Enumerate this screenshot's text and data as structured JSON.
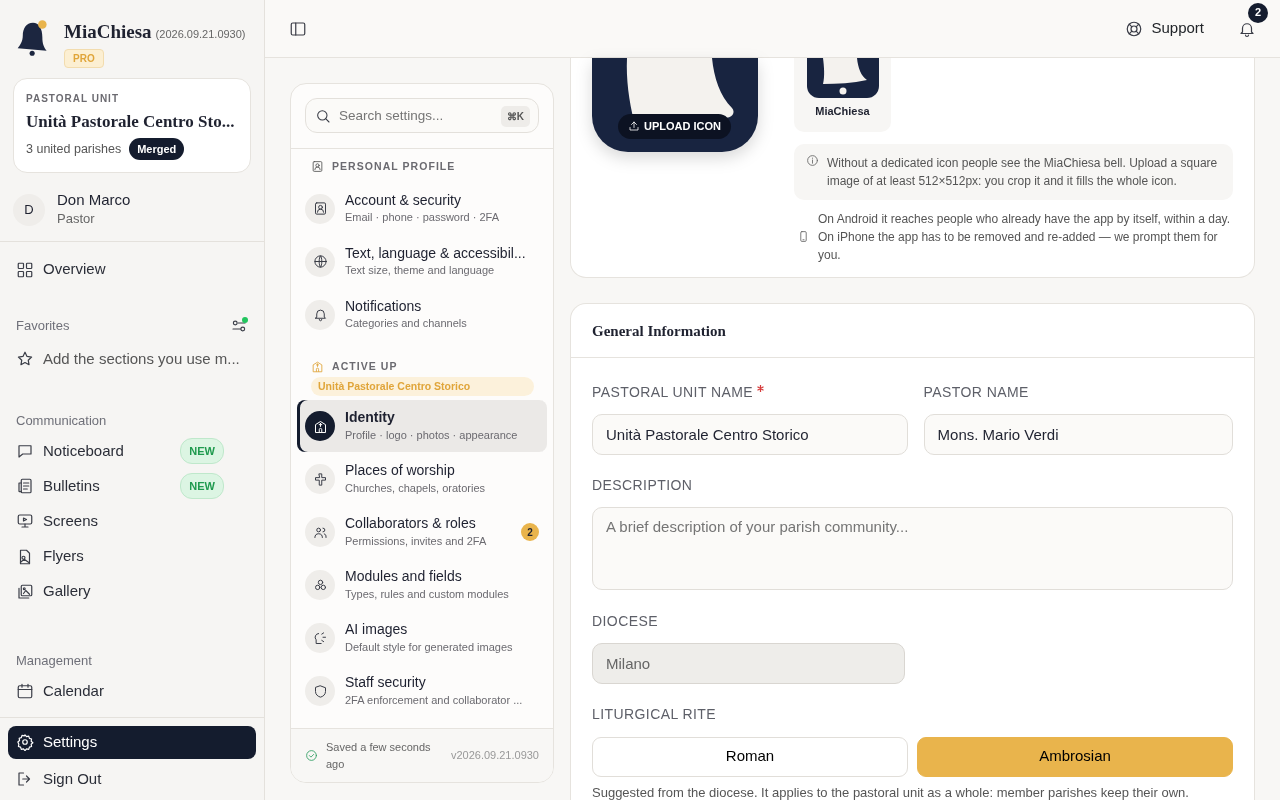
{
  "app": {
    "name": "MiaChiesa",
    "version": "(2026.09.21.0930)",
    "plan": "PRO"
  },
  "unit_card": {
    "label": "PASTORAL UNIT",
    "name": "Unità Pastorale Centro Sto...",
    "subtitle": "3 united parishes",
    "badge": "Merged"
  },
  "user": {
    "initial": "D",
    "name": "Don Marco",
    "role": "Pastor"
  },
  "overview": {
    "label": "Overview",
    "selected": false
  },
  "favorites": {
    "title": "Favorites",
    "hint": "Add the sections you use m..."
  },
  "nav_groups": [
    {
      "title": "Communication",
      "items": [
        {
          "label": "Noticeboard",
          "badge": "NEW",
          "selected": false
        },
        {
          "label": "Bulletins",
          "badge": "NEW",
          "selected": false
        },
        {
          "label": "Screens",
          "selected": false
        },
        {
          "label": "Flyers",
          "selected": false
        },
        {
          "label": "Gallery",
          "selected": false
        }
      ]
    },
    {
      "title": "Management",
      "items": [
        {
          "label": "Calendar",
          "selected": false
        }
      ]
    }
  ],
  "bottom_nav": [
    {
      "label": "Settings",
      "selected": true
    },
    {
      "label": "Sign Out",
      "selected": false
    }
  ],
  "header": {
    "support": "Support",
    "notifications": "2"
  },
  "settings_nav": {
    "search_placeholder": "Search settings...",
    "shortcut": "⌘K",
    "sections": [
      {
        "title": "PERSONAL PROFILE",
        "items": [
          {
            "title": "Account & security",
            "subtitle": "Email · phone · password · 2FA",
            "selected": false
          },
          {
            "title": "Text, language & accessibil...",
            "subtitle": "Text size, theme and language",
            "selected": false
          },
          {
            "title": "Notifications",
            "subtitle": "Categories and channels",
            "selected": false
          }
        ]
      },
      {
        "title": "ACTIVE UP",
        "tag": "Unità Pastorale Centro Storico",
        "items": [
          {
            "title": "Identity",
            "subtitle": "Profile · logo · photos · appearance",
            "selected": true
          },
          {
            "title": "Places of worship",
            "subtitle": "Churches, chapels, oratories",
            "selected": false
          },
          {
            "title": "Collaborators & roles",
            "subtitle": "Permissions, invites and 2FA",
            "badge": "2",
            "selected": false
          },
          {
            "title": "Modules and fields",
            "subtitle": "Types, rules and custom modules",
            "selected": false
          },
          {
            "title": "AI images",
            "subtitle": "Default style for generated images",
            "selected": false
          },
          {
            "title": "Staff security",
            "subtitle": "2FA enforcement and collaborator ...",
            "selected": false
          }
        ]
      }
    ],
    "footer": {
      "saved": "Saved a few seconds ago",
      "version": "v2026.09.21.0930"
    }
  },
  "icon_card": {
    "upload_label": "UPLOAD ICON",
    "preview_label": "MiaChiesa",
    "info": "Without a dedicated icon people see the MiaChiesa bell. Upload a square image of at least 512×512px: you crop it and it fills the whole icon.",
    "note": "On Android it reaches people who already have the app by itself, within a day. On iPhone the app has to be removed and re-added — we prompt them for you."
  },
  "general": {
    "title": "General Information",
    "fields": [
      {
        "label": "PASTORAL UNIT NAME",
        "required": true,
        "value": "Unità Pastorale Centro Storico",
        "disabled": false
      },
      {
        "label": "PASTOR NAME",
        "required": false,
        "value": "Mons. Mario Verdi",
        "disabled": false
      },
      {
        "label": "DESCRIPTION",
        "required": false,
        "placeholder": "A brief description of your parish community...",
        "disabled": false
      },
      {
        "label": "DIOCESE",
        "required": false,
        "value": "Milano",
        "disabled": true
      }
    ],
    "rite": {
      "label": "LITURGICAL RITE",
      "options": [
        {
          "label": "Roman",
          "selected": false
        },
        {
          "label": "Ambrosian",
          "selected": true
        }
      ],
      "help": "Suggested from the diocese. It applies to the pastoral unit as a whole: member parishes keep their own."
    }
  }
}
